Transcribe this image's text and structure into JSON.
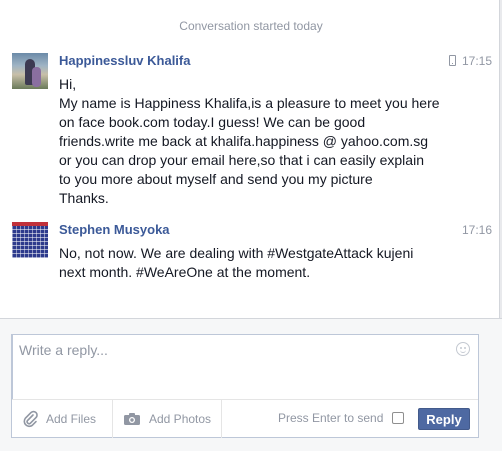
{
  "conversation": {
    "started_label": "Conversation started today"
  },
  "messages": [
    {
      "sender": "Happinessluv Khalifa",
      "time": "17:15",
      "via_mobile": true,
      "lines": [
        "Hi,",
        "My name is Happiness Khalifa,is a pleasure to meet you here",
        "on face book.com today.I guess! We can be good",
        "friends.write me back at khalifa.happiness @ yahoo.com.sg",
        "or you can drop your email here,so that i can easily explain",
        "to you more about myself and send you my picture",
        "Thanks."
      ]
    },
    {
      "sender": "Stephen Musyoka",
      "time": "17:16",
      "via_mobile": false,
      "lines": [
        "No, not now. We are dealing with #WestgateAttack kujeni",
        "next month. #WeAreOne at the moment."
      ]
    }
  ],
  "composer": {
    "placeholder": "Write a reply...",
    "add_files_label": "Add Files",
    "add_photos_label": "Add Photos",
    "press_enter_label": "Press Enter to send",
    "reply_label": "Reply",
    "press_enter_checked": false
  },
  "colors": {
    "link_blue": "#3b5998",
    "button_blue": "#4e69a2",
    "muted_gray": "#9197a3"
  },
  "icons": [
    "mobile-icon",
    "emoji-icon",
    "paperclip-icon",
    "camera-icon"
  ]
}
